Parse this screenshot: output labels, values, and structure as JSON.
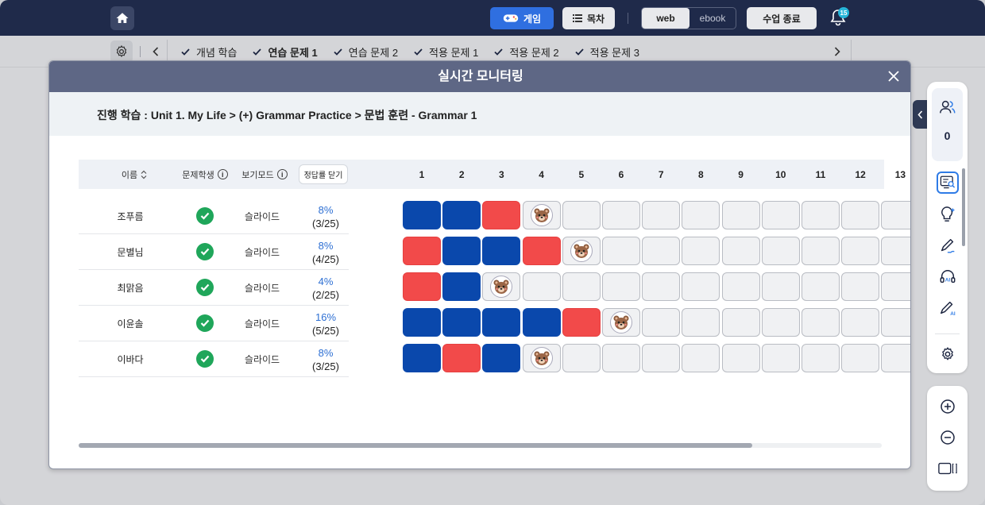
{
  "topbar": {
    "game_label": "게임",
    "toc_label": "목차",
    "mode_web": "web",
    "mode_ebook": "ebook",
    "end_class_label": "수업 종료",
    "notification_count": "15"
  },
  "nav": {
    "tabs": [
      {
        "label": "개념 학습",
        "active": false
      },
      {
        "label": "연습 문제 1",
        "active": true
      },
      {
        "label": "연습 문제 2",
        "active": false
      },
      {
        "label": "적용 문제 1",
        "active": false
      },
      {
        "label": "적용 문제 2",
        "active": false
      },
      {
        "label": "적용 문제 3",
        "active": false
      }
    ]
  },
  "modal": {
    "title": "실시간 모니터링",
    "breadcrumb": "진행 학습 : Unit 1. My Life > (+) Grammar Practice > 문법 훈련 - Grammar 1"
  },
  "table": {
    "headers": {
      "name": "이름",
      "problem_student": "문제학생",
      "view_mode": "보기모드",
      "hide_answers": "정답률 닫기"
    },
    "question_numbers": [
      "1",
      "2",
      "3",
      "4",
      "5",
      "6",
      "7",
      "8",
      "9",
      "10",
      "11",
      "12",
      "13"
    ],
    "rows": [
      {
        "name": "조푸름",
        "mode": "슬라이드",
        "pct": "8%",
        "frac": "(3/25)",
        "answers": [
          "correct",
          "correct",
          "wrong",
          "current"
        ]
      },
      {
        "name": "문별님",
        "mode": "슬라이드",
        "pct": "8%",
        "frac": "(4/25)",
        "answers": [
          "wrong",
          "correct",
          "correct",
          "wrong",
          "current"
        ]
      },
      {
        "name": "최맑음",
        "mode": "슬라이드",
        "pct": "4%",
        "frac": "(2/25)",
        "answers": [
          "wrong",
          "correct",
          "current"
        ]
      },
      {
        "name": "이윤솔",
        "mode": "슬라이드",
        "pct": "16%",
        "frac": "(5/25)",
        "answers": [
          "correct",
          "correct",
          "correct",
          "correct",
          "wrong",
          "current"
        ]
      },
      {
        "name": "이바다",
        "mode": "슬라이드",
        "pct": "8%",
        "frac": "(3/25)",
        "answers": [
          "correct",
          "wrong",
          "correct",
          "current"
        ]
      }
    ]
  },
  "toolbar": {
    "student_count": "0"
  },
  "colors": {
    "correct": "#0a48ac",
    "wrong": "#f24a4a",
    "header_bg": "#1f2a4a",
    "accent": "#2f6fe0"
  }
}
